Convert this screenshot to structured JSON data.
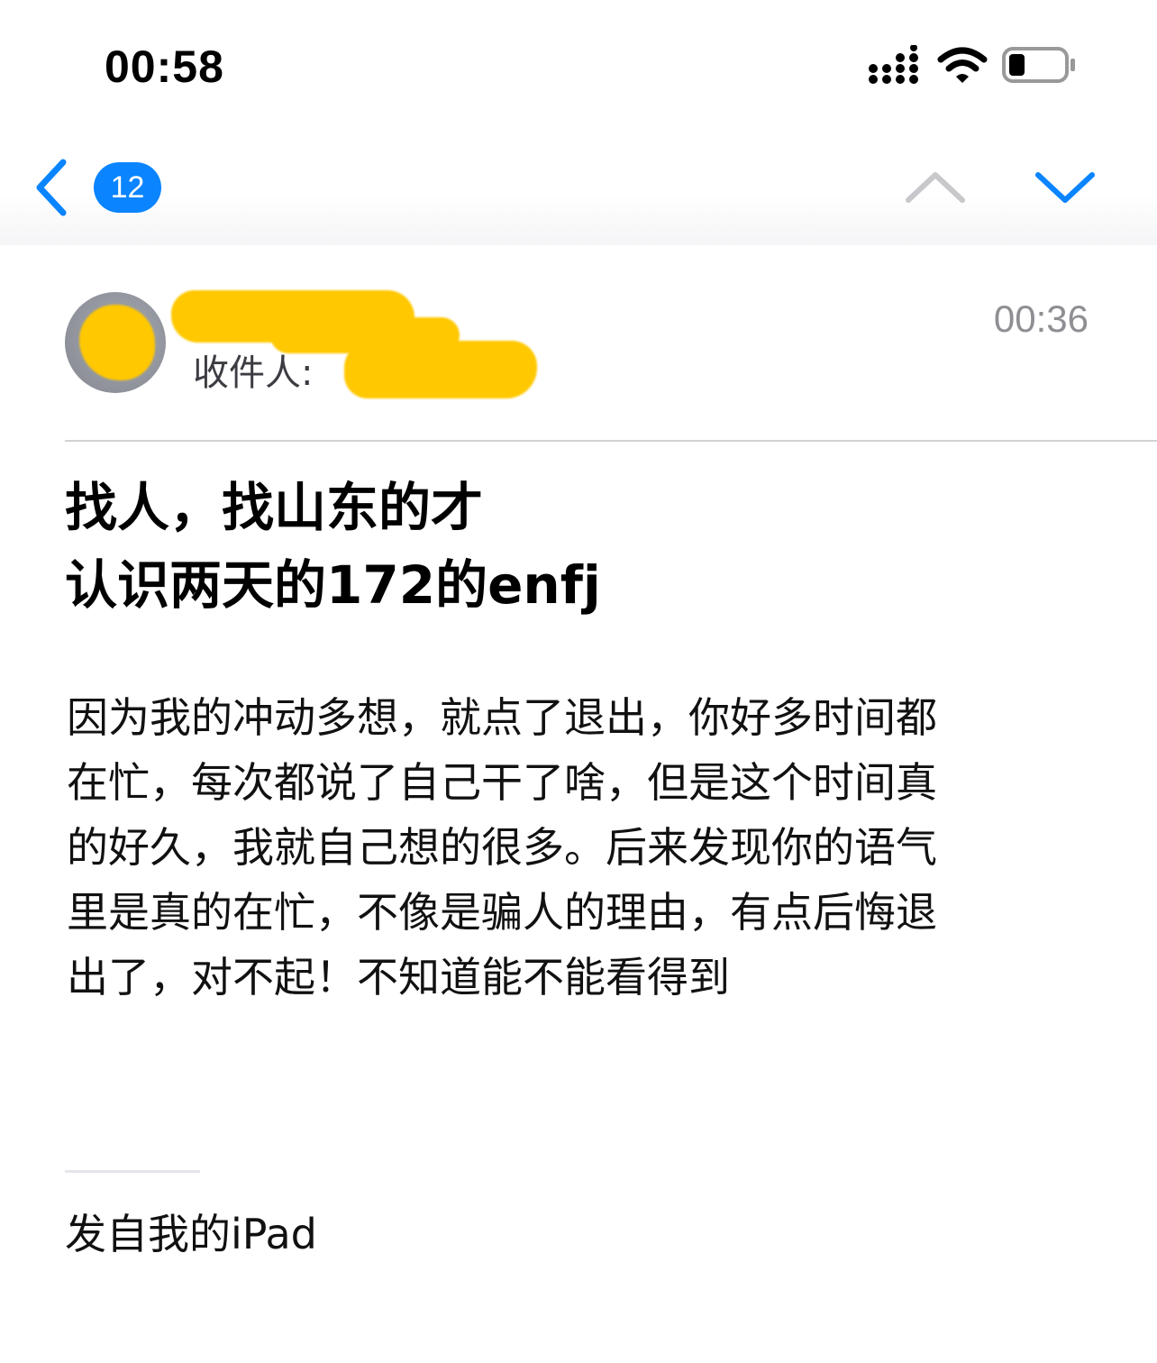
{
  "status_bar": {
    "time": "00:58",
    "signal_icon": "cellular-signal-icon",
    "wifi_icon": "wifi-icon",
    "battery_icon": "battery-icon",
    "battery_level": 0.3
  },
  "nav": {
    "back_icon": "chevron-left-icon",
    "unread_count": "12",
    "prev_icon": "chevron-up-icon",
    "next_icon": "chevron-down-icon",
    "accent_color": "#0a84ff",
    "disabled_color": "#c7c7cc"
  },
  "message": {
    "received_time": "00:36",
    "to_label": "收件人:",
    "subject_lines": [
      "找人，找山东的才",
      "认识两天的172的enfj"
    ],
    "body_lines": [
      "因为我的冲动多想，就点了退出，你好多时间都",
      "在忙，每次都说了自己干了啥，但是这个时间真",
      "的好久，我就自己想的很多。后来发现你的语气",
      "里是真的在忙，不像是骗人的理由，有点后悔退",
      "出了，对不起！不知道能不能看得到"
    ],
    "signature": "发自我的iPad",
    "redaction_color": "#ffc800"
  }
}
